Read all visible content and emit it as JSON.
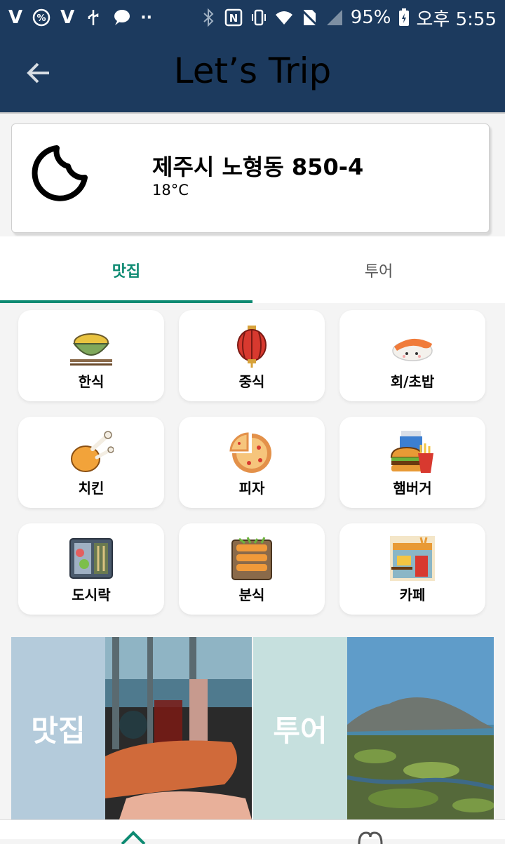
{
  "status_bar": {
    "battery": "95%",
    "time": "오후 5:55",
    "left_icons": [
      "v3-icon",
      "percent-icon",
      "v3-icon",
      "usb-icon",
      "chat-icon",
      "more-dots-icon"
    ],
    "right_icons": [
      "bluetooth-icon",
      "nfc-icon",
      "vibrate-icon",
      "wifi-icon",
      "no-sim-icon",
      "signal-icon",
      "battery-icon"
    ]
  },
  "app_bar": {
    "title": "Let’s Trip",
    "back_icon": "arrow-back-icon"
  },
  "weather": {
    "location": "제주시 노형동 850-4",
    "temperature": "18°C",
    "icon": "moon-icon"
  },
  "tabs": [
    {
      "label": "맛집",
      "active": true
    },
    {
      "label": "투어",
      "active": false
    }
  ],
  "categories": [
    {
      "label": "한식",
      "icon": "rice-bowl-icon"
    },
    {
      "label": "중식",
      "icon": "lantern-icon"
    },
    {
      "label": "회/초밥",
      "icon": "sushi-icon"
    },
    {
      "label": "치킨",
      "icon": "chicken-icon"
    },
    {
      "label": "피자",
      "icon": "pizza-icon"
    },
    {
      "label": "햄버거",
      "icon": "burger-icon"
    },
    {
      "label": "도시락",
      "icon": "lunchbox-icon"
    },
    {
      "label": "분식",
      "icon": "skewer-icon"
    },
    {
      "label": "카페",
      "icon": "cafe-icon"
    }
  ],
  "banners": [
    {
      "label": "맛집",
      "color": "#b4cbdb"
    },
    {
      "label": "투어",
      "color": "#c6e0de"
    }
  ],
  "colors": {
    "primary": "#1c3a5e",
    "accent": "#0d8a72"
  }
}
